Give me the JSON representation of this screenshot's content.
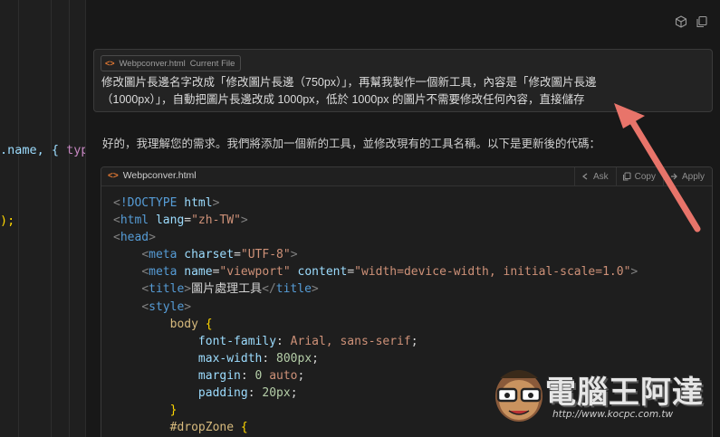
{
  "editor_fragments": {
    "line1_name": ".name, {",
    "line1_type": " typ",
    "line2": ");"
  },
  "user_message": {
    "file_chip": {
      "filename": "Webpconver.html",
      "label": "Current File"
    },
    "line1": "修改圖片長邊名字改成「修改圖片長邊（750px）」，再幫我製作一個新工具，內容是「修改圖片長邊",
    "line2": "（1000px）」，自動把圖片長邊改成 1000px，低於 1000px 的圖片不需要修改任何內容，直接儲存"
  },
  "assistant_reply": "好的，我理解您的需求。我們將添加一個新的工具，並修改現有的工具名稱。以下是更新後的代碼：",
  "code_block": {
    "filename": "Webpconver.html",
    "actions": {
      "ask": "Ask",
      "copy": "Copy",
      "apply": "Apply"
    }
  },
  "watermark": {
    "title": "電腦王阿達",
    "url": "http://www.kocpc.com.tw"
  },
  "colors": {
    "accent_orange": "#e37933",
    "arrow": "#e8746a"
  },
  "icons": [
    "cube-icon",
    "copy-icon",
    "html-file-icon",
    "ask-icon",
    "copy-icon",
    "apply-icon"
  ]
}
